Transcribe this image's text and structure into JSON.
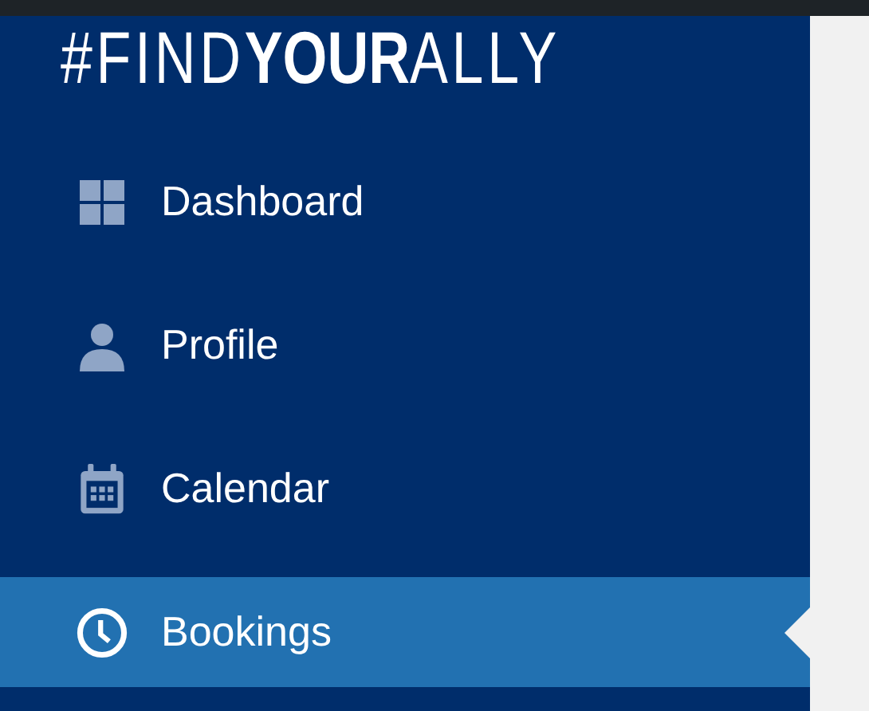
{
  "logo": "#FIND**YOUR**ALLY",
  "menu": [
    {
      "label": "Dashboard",
      "selected": false
    },
    {
      "label": "Profile",
      "selected": false
    },
    {
      "label": "Calendar",
      "selected": false
    },
    {
      "label": "Bookings",
      "selected": true
    }
  ]
}
